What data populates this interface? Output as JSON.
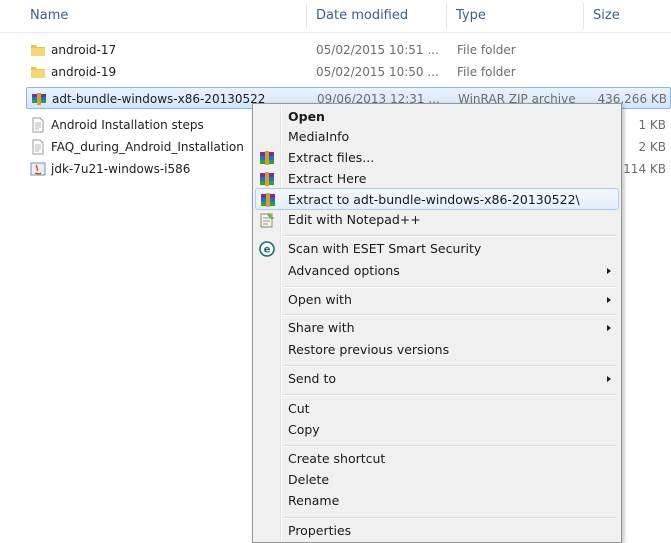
{
  "columns": {
    "name": "Name",
    "date_modified": "Date modified",
    "type": "Type",
    "size": "Size"
  },
  "files": [
    {
      "name": "android-17",
      "date": "05/02/2015 10:51 ...",
      "type": "File folder",
      "size": "",
      "icon": "folder-icon"
    },
    {
      "name": "android-19",
      "date": "05/02/2015 10:50 ...",
      "type": "File folder",
      "size": "",
      "icon": "folder-icon"
    },
    {
      "name": "adt-bundle-windows-x86-20130522",
      "date": "09/06/2013 12:31 ...",
      "type": "WinRAR ZIP archive",
      "size": "436,266 KB",
      "icon": "winrar-archive-icon"
    },
    {
      "name": "Android Installation steps",
      "date": "",
      "type": "",
      "size": "1 KB",
      "icon": "text-file-icon"
    },
    {
      "name": "FAQ_during_Android_Installation",
      "date": "",
      "type": "",
      "size": "2 KB",
      "icon": "text-file-icon"
    },
    {
      "name": "jdk-7u21-windows-i586",
      "date": "",
      "type": "",
      "size": "1,114 KB",
      "icon": "java-installer-icon"
    }
  ],
  "context_menu": {
    "open": "Open",
    "mediainfo": "MediaInfo",
    "extract_files": "Extract files...",
    "extract_here": "Extract Here",
    "extract_to": "Extract to adt-bundle-windows-x86-20130522\\",
    "edit_notepad": "Edit with Notepad++",
    "scan_eset": "Scan with ESET Smart Security",
    "advanced_options": "Advanced options",
    "open_with": "Open with",
    "share_with": "Share with",
    "restore_previous": "Restore previous versions",
    "send_to": "Send to",
    "cut": "Cut",
    "copy": "Copy",
    "create_shortcut": "Create shortcut",
    "delete": "Delete",
    "rename": "Rename",
    "properties": "Properties"
  },
  "colors": {
    "selection": "#d3e6fb",
    "menu_background": "#f0f0f0",
    "header_text": "#3b5f8a"
  }
}
